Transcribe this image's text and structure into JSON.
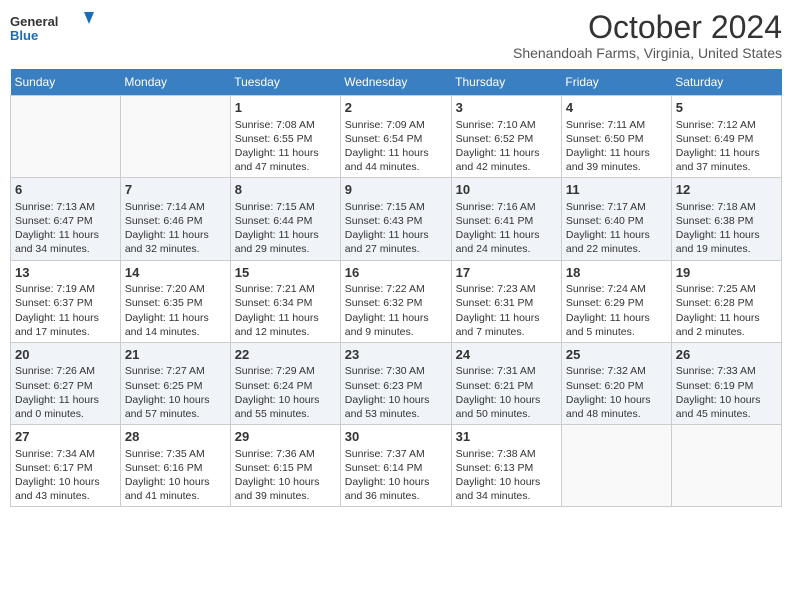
{
  "header": {
    "logo_line1": "General",
    "logo_line2": "Blue",
    "month": "October 2024",
    "location": "Shenandoah Farms, Virginia, United States"
  },
  "days_of_week": [
    "Sunday",
    "Monday",
    "Tuesday",
    "Wednesday",
    "Thursday",
    "Friday",
    "Saturday"
  ],
  "weeks": [
    [
      {
        "day": "",
        "content": ""
      },
      {
        "day": "",
        "content": ""
      },
      {
        "day": "1",
        "content": "Sunrise: 7:08 AM\nSunset: 6:55 PM\nDaylight: 11 hours and 47 minutes."
      },
      {
        "day": "2",
        "content": "Sunrise: 7:09 AM\nSunset: 6:54 PM\nDaylight: 11 hours and 44 minutes."
      },
      {
        "day": "3",
        "content": "Sunrise: 7:10 AM\nSunset: 6:52 PM\nDaylight: 11 hours and 42 minutes."
      },
      {
        "day": "4",
        "content": "Sunrise: 7:11 AM\nSunset: 6:50 PM\nDaylight: 11 hours and 39 minutes."
      },
      {
        "day": "5",
        "content": "Sunrise: 7:12 AM\nSunset: 6:49 PM\nDaylight: 11 hours and 37 minutes."
      }
    ],
    [
      {
        "day": "6",
        "content": "Sunrise: 7:13 AM\nSunset: 6:47 PM\nDaylight: 11 hours and 34 minutes."
      },
      {
        "day": "7",
        "content": "Sunrise: 7:14 AM\nSunset: 6:46 PM\nDaylight: 11 hours and 32 minutes."
      },
      {
        "day": "8",
        "content": "Sunrise: 7:15 AM\nSunset: 6:44 PM\nDaylight: 11 hours and 29 minutes."
      },
      {
        "day": "9",
        "content": "Sunrise: 7:15 AM\nSunset: 6:43 PM\nDaylight: 11 hours and 27 minutes."
      },
      {
        "day": "10",
        "content": "Sunrise: 7:16 AM\nSunset: 6:41 PM\nDaylight: 11 hours and 24 minutes."
      },
      {
        "day": "11",
        "content": "Sunrise: 7:17 AM\nSunset: 6:40 PM\nDaylight: 11 hours and 22 minutes."
      },
      {
        "day": "12",
        "content": "Sunrise: 7:18 AM\nSunset: 6:38 PM\nDaylight: 11 hours and 19 minutes."
      }
    ],
    [
      {
        "day": "13",
        "content": "Sunrise: 7:19 AM\nSunset: 6:37 PM\nDaylight: 11 hours and 17 minutes."
      },
      {
        "day": "14",
        "content": "Sunrise: 7:20 AM\nSunset: 6:35 PM\nDaylight: 11 hours and 14 minutes."
      },
      {
        "day": "15",
        "content": "Sunrise: 7:21 AM\nSunset: 6:34 PM\nDaylight: 11 hours and 12 minutes."
      },
      {
        "day": "16",
        "content": "Sunrise: 7:22 AM\nSunset: 6:32 PM\nDaylight: 11 hours and 9 minutes."
      },
      {
        "day": "17",
        "content": "Sunrise: 7:23 AM\nSunset: 6:31 PM\nDaylight: 11 hours and 7 minutes."
      },
      {
        "day": "18",
        "content": "Sunrise: 7:24 AM\nSunset: 6:29 PM\nDaylight: 11 hours and 5 minutes."
      },
      {
        "day": "19",
        "content": "Sunrise: 7:25 AM\nSunset: 6:28 PM\nDaylight: 11 hours and 2 minutes."
      }
    ],
    [
      {
        "day": "20",
        "content": "Sunrise: 7:26 AM\nSunset: 6:27 PM\nDaylight: 11 hours and 0 minutes."
      },
      {
        "day": "21",
        "content": "Sunrise: 7:27 AM\nSunset: 6:25 PM\nDaylight: 10 hours and 57 minutes."
      },
      {
        "day": "22",
        "content": "Sunrise: 7:29 AM\nSunset: 6:24 PM\nDaylight: 10 hours and 55 minutes."
      },
      {
        "day": "23",
        "content": "Sunrise: 7:30 AM\nSunset: 6:23 PM\nDaylight: 10 hours and 53 minutes."
      },
      {
        "day": "24",
        "content": "Sunrise: 7:31 AM\nSunset: 6:21 PM\nDaylight: 10 hours and 50 minutes."
      },
      {
        "day": "25",
        "content": "Sunrise: 7:32 AM\nSunset: 6:20 PM\nDaylight: 10 hours and 48 minutes."
      },
      {
        "day": "26",
        "content": "Sunrise: 7:33 AM\nSunset: 6:19 PM\nDaylight: 10 hours and 45 minutes."
      }
    ],
    [
      {
        "day": "27",
        "content": "Sunrise: 7:34 AM\nSunset: 6:17 PM\nDaylight: 10 hours and 43 minutes."
      },
      {
        "day": "28",
        "content": "Sunrise: 7:35 AM\nSunset: 6:16 PM\nDaylight: 10 hours and 41 minutes."
      },
      {
        "day": "29",
        "content": "Sunrise: 7:36 AM\nSunset: 6:15 PM\nDaylight: 10 hours and 39 minutes."
      },
      {
        "day": "30",
        "content": "Sunrise: 7:37 AM\nSunset: 6:14 PM\nDaylight: 10 hours and 36 minutes."
      },
      {
        "day": "31",
        "content": "Sunrise: 7:38 AM\nSunset: 6:13 PM\nDaylight: 10 hours and 34 minutes."
      },
      {
        "day": "",
        "content": ""
      },
      {
        "day": "",
        "content": ""
      }
    ]
  ]
}
